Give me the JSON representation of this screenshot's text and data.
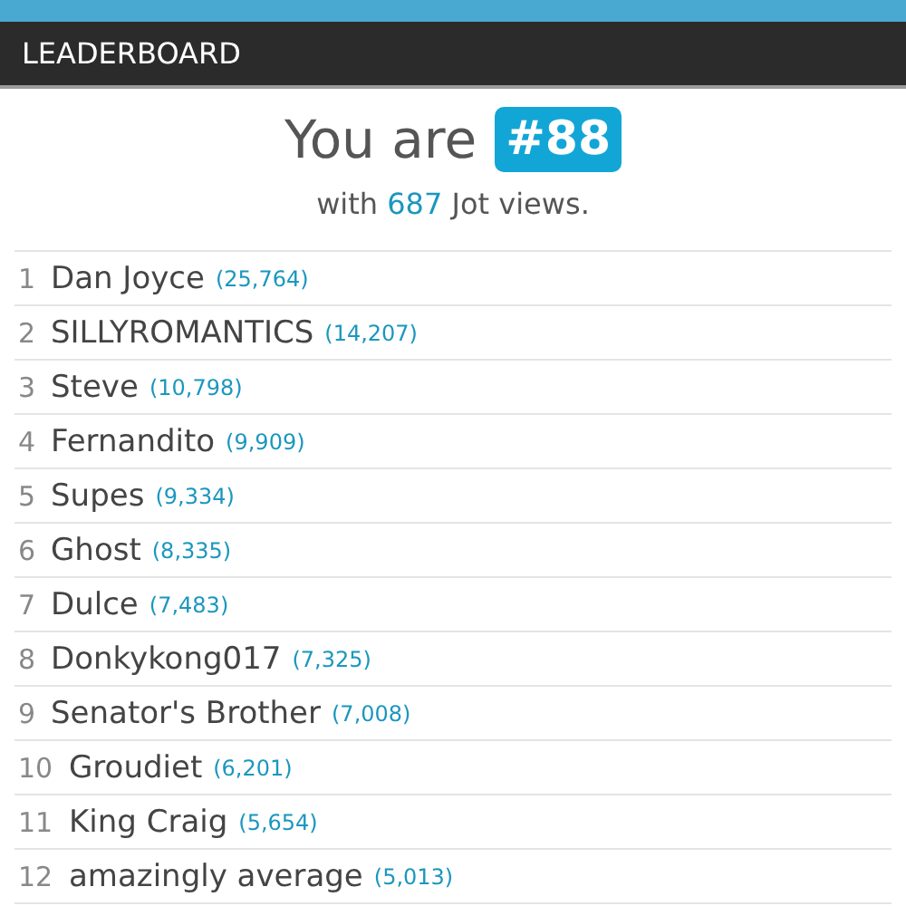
{
  "section_title": "LEADERBOARD",
  "rank": {
    "prefix": "You are",
    "value": "#88",
    "before_views": "with",
    "views": "687",
    "after_views": "Jot views."
  },
  "leaders": [
    {
      "rank": "1",
      "name": "Dan Joyce",
      "views": "(25,764)"
    },
    {
      "rank": "2",
      "name": "SILLYROMANTICS",
      "views": "(14,207)"
    },
    {
      "rank": "3",
      "name": "Steve",
      "views": "(10,798)"
    },
    {
      "rank": "4",
      "name": "Fernandito",
      "views": "(9,909)"
    },
    {
      "rank": "5",
      "name": "Supes",
      "views": "(9,334)"
    },
    {
      "rank": "6",
      "name": "Ghost",
      "views": "(8,335)"
    },
    {
      "rank": "7",
      "name": "Dulce",
      "views": "(7,483)"
    },
    {
      "rank": "8",
      "name": "Donkykong017",
      "views": "(7,325)"
    },
    {
      "rank": "9",
      "name": "Senator's Brother",
      "views": "(7,008)"
    },
    {
      "rank": "10",
      "name": "Groudiet",
      "views": "(6,201)"
    },
    {
      "rank": "11",
      "name": "King Craig",
      "views": "(5,654)"
    },
    {
      "rank": "12",
      "name": "amazingly average",
      "views": "(5,013)"
    }
  ]
}
